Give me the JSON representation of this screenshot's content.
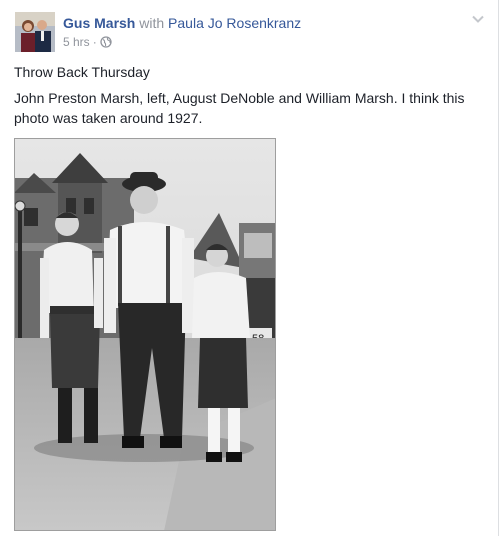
{
  "post": {
    "author": "Gus Marsh",
    "with_text": "with",
    "tagged": "Paula Jo Rosenkranz",
    "timestamp": "5 hrs",
    "separator": "·",
    "audience_icon": "globe-icon",
    "menu_icon": "chevron-down-icon",
    "lines": [
      "Throw Back Thursday",
      "John Preston Marsh, left, August DeNoble and William Marsh. I think this photo was taken around 1927."
    ],
    "photo_plate_text": "58"
  },
  "colors": {
    "link": "#365899",
    "meta": "#90949c",
    "text": "#1d2129"
  }
}
